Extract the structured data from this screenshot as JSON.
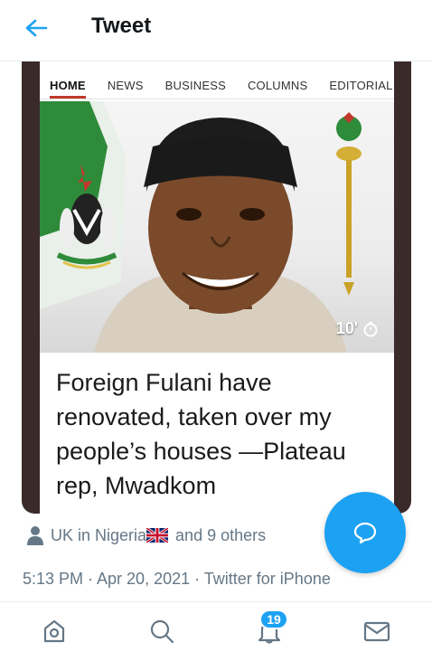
{
  "header": {
    "title": "Tweet"
  },
  "article": {
    "nav": [
      "HOME",
      "NEWS",
      "BUSINESS",
      "COLUMNS",
      "EDITORIAL"
    ],
    "active_nav": "HOME",
    "timer": "10'",
    "headline": "Foreign Fulani have renovated, taken over my people’s houses —Plateau rep, Mwadkom"
  },
  "liked": {
    "text_a": "UK in Nigeria",
    "text_b": "and 9 others"
  },
  "meta": "5:13 PM · Apr 20, 2021 · Twitter for iPhone",
  "notifications": {
    "badge": "19"
  },
  "colors": {
    "accent": "#1da1f2",
    "muted": "#657786",
    "card_border": "#3b2a2a"
  },
  "icons": [
    "back-arrow-icon",
    "home-icon",
    "search-icon",
    "bell-icon",
    "mail-icon",
    "reply-icon",
    "person-icon",
    "uk-flag-icon",
    "clock-icon"
  ]
}
